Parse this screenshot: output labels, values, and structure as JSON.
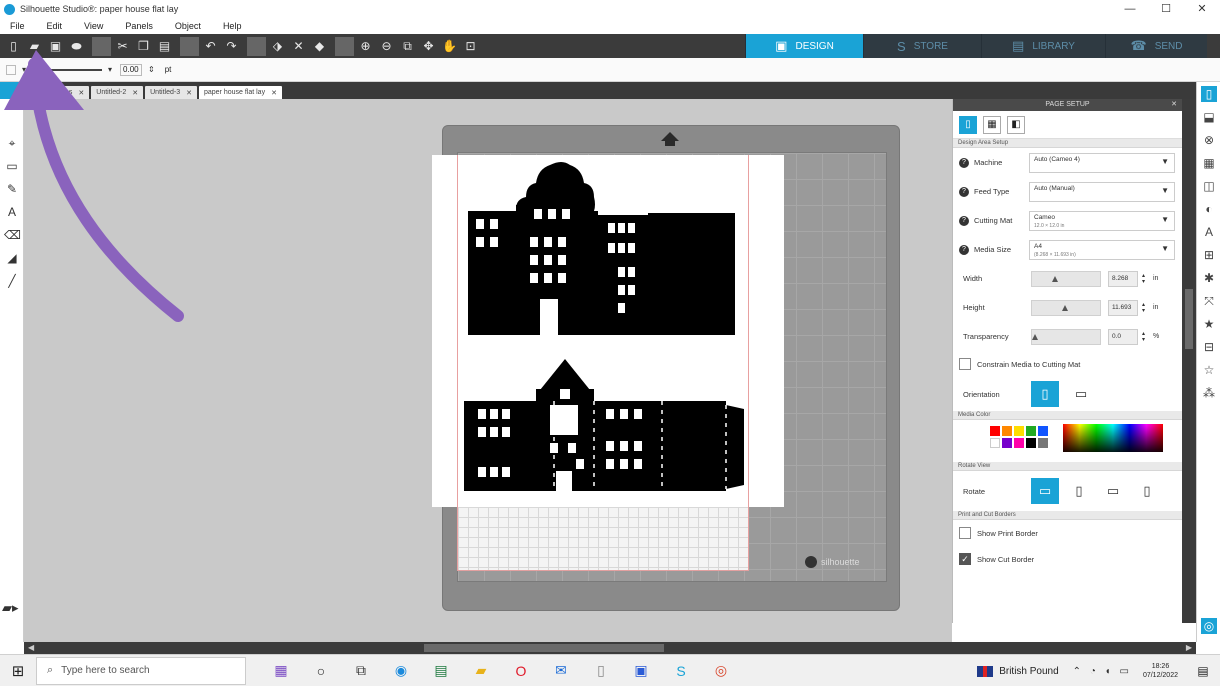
{
  "window": {
    "title": "Silhouette Studio®: paper house flat lay",
    "controls": [
      "—",
      "☐",
      "✕"
    ]
  },
  "menu": [
    "File",
    "Edit",
    "View",
    "Panels",
    "Object",
    "Help"
  ],
  "toolbar_icons": [
    {
      "name": "new-document-icon",
      "glyph": "▯"
    },
    {
      "name": "open-folder-icon",
      "glyph": "▰"
    },
    {
      "name": "save-icon",
      "glyph": "▣"
    },
    {
      "name": "print-icon",
      "glyph": "⬬"
    },
    {
      "name": "cut-icon",
      "glyph": "✂"
    },
    {
      "name": "copy-icon",
      "glyph": "❐"
    },
    {
      "name": "paste-icon",
      "glyph": "▤"
    },
    {
      "name": "undo-icon",
      "glyph": "↶"
    },
    {
      "name": "redo-icon",
      "glyph": "↷"
    },
    {
      "name": "select-icon",
      "glyph": "⬗"
    },
    {
      "name": "delete-icon",
      "glyph": "✕"
    },
    {
      "name": "fill-icon",
      "glyph": "◆"
    },
    {
      "name": "zoom-in-icon",
      "glyph": "⊕"
    },
    {
      "name": "zoom-out-icon",
      "glyph": "⊖"
    },
    {
      "name": "zoom-select-icon",
      "glyph": "⧉"
    },
    {
      "name": "move-icon",
      "glyph": "✥"
    },
    {
      "name": "hand-icon",
      "glyph": "✋"
    },
    {
      "name": "fit-page-icon",
      "glyph": "⊡"
    }
  ],
  "nav_tabs": [
    {
      "label": "DESIGN",
      "glyph": "▣",
      "active": true,
      "width": 118
    },
    {
      "label": "STORE",
      "glyph": "S",
      "active": false,
      "width": 118
    },
    {
      "label": "LIBRARY",
      "glyph": "▤",
      "active": false,
      "width": 124
    },
    {
      "label": "SEND",
      "glyph": "☎",
      "active": false,
      "width": 102
    }
  ],
  "options_bar": {
    "line_value": "0.00",
    "unit": "pt"
  },
  "doc_tabs": [
    {
      "label": "es",
      "active": false
    },
    {
      "label": "Untitled-2",
      "active": false
    },
    {
      "label": "Untitled-3",
      "active": false
    },
    {
      "label": "paper house flat lay",
      "active": true
    }
  ],
  "left_tools": [
    {
      "name": "point-edit-tool-icon",
      "glyph": "⌖"
    },
    {
      "name": "rectangle-tool-icon",
      "glyph": "▭"
    },
    {
      "name": "pencil-tool-icon",
      "glyph": "✎"
    },
    {
      "name": "text-tool-icon",
      "glyph": "A"
    },
    {
      "name": "eraser-tool-icon",
      "glyph": "⌫"
    },
    {
      "name": "knife-tool-icon",
      "glyph": "◢"
    },
    {
      "name": "brush-tool-icon",
      "glyph": "╱"
    }
  ],
  "page_setup": {
    "title": "PAGE SETUP",
    "section_design_area": "Design Area Setup",
    "machine_label": "Machine",
    "machine_value": "Auto (Cameo 4)",
    "feed_label": "Feed Type",
    "feed_value": "Auto (Manual)",
    "mat_label": "Cutting Mat",
    "mat_value": "Cameo",
    "mat_sub": "12.0 × 12.0 in",
    "media_label": "Media Size",
    "media_value": "A4",
    "media_sub": "(8.268 × 11.693 in)",
    "width_label": "Width",
    "width_value": "8.268",
    "width_unit": "in",
    "height_label": "Height",
    "height_value": "11.693",
    "height_unit": "in",
    "transparency_label": "Transparency",
    "transparency_value": "0.0",
    "transparency_unit": "%",
    "constrain_label": "Constrain Media to Cutting Mat",
    "orientation_label": "Orientation",
    "section_media_color": "Media Color",
    "swatches": [
      "#ff0000",
      "#ff8800",
      "#ffdd00",
      "#22aa22",
      "#1155ff",
      "#ffffff",
      "#7700cc",
      "#ff00aa",
      "#000000",
      "#777777"
    ],
    "section_rotate": "Rotate View",
    "rotate_label": "Rotate",
    "section_borders": "Print and Cut Borders",
    "print_border_label": "Show Print Border",
    "cut_border_label": "Show Cut Border"
  },
  "right_strip": [
    {
      "name": "page-setup-panel-icon",
      "glyph": "▯",
      "active": true
    },
    {
      "name": "cut-settings-panel-icon",
      "glyph": "⬓",
      "active": false
    },
    {
      "name": "registration-panel-icon",
      "glyph": "⊗",
      "active": false
    },
    {
      "name": "grid-panel-icon",
      "glyph": "▦",
      "active": false
    },
    {
      "name": "layers-panel-icon",
      "glyph": "◫",
      "active": false
    },
    {
      "name": "fill-panel-icon",
      "glyph": "◐",
      "active": false
    },
    {
      "name": "text-style-panel-icon",
      "glyph": "A",
      "active": false
    },
    {
      "name": "align-panel-icon",
      "glyph": "⊞",
      "active": false
    },
    {
      "name": "replicate-panel-icon",
      "glyph": "✱",
      "active": false
    },
    {
      "name": "transform-panel-icon",
      "glyph": "⤧",
      "active": false
    },
    {
      "name": "star-panel-icon",
      "glyph": "★",
      "active": false
    },
    {
      "name": "library-panel-icon",
      "glyph": "⊟",
      "active": false
    },
    {
      "name": "favorite-panel-icon",
      "glyph": "☆",
      "active": false
    },
    {
      "name": "offset-panel-icon",
      "glyph": "⁂",
      "active": false
    }
  ],
  "mat_brand": "silhouette",
  "taskbar": {
    "search_placeholder": "Type here to search",
    "apps": [
      {
        "name": "widgets-app-icon",
        "glyph": "▦",
        "color": "#7b4cc4"
      },
      {
        "name": "cortana-icon",
        "glyph": "○",
        "color": "#222"
      },
      {
        "name": "task-view-icon",
        "glyph": "⧉",
        "color": "#333"
      },
      {
        "name": "edge-browser-icon",
        "glyph": "◉",
        "color": "#1a8adc"
      },
      {
        "name": "excel-app-icon",
        "glyph": "▤",
        "color": "#1d7a3e"
      },
      {
        "name": "file-explorer-icon",
        "glyph": "▰",
        "color": "#e8b21a"
      },
      {
        "name": "opera-browser-icon",
        "glyph": "O",
        "color": "#e01a2a"
      },
      {
        "name": "mail-app-icon",
        "glyph": "✉",
        "color": "#1a6ad6"
      },
      {
        "name": "notes-app-icon",
        "glyph": "▯",
        "color": "#888"
      },
      {
        "name": "store-app-icon",
        "glyph": "▣",
        "color": "#2a5bd6"
      },
      {
        "name": "silhouette-app-icon",
        "glyph": "S",
        "color": "#1aa3d6"
      },
      {
        "name": "chrome-browser-icon",
        "glyph": "◎",
        "color": "#d8442a"
      }
    ],
    "language": "British Pound",
    "time": "18:26",
    "date": "07/12/2022"
  }
}
